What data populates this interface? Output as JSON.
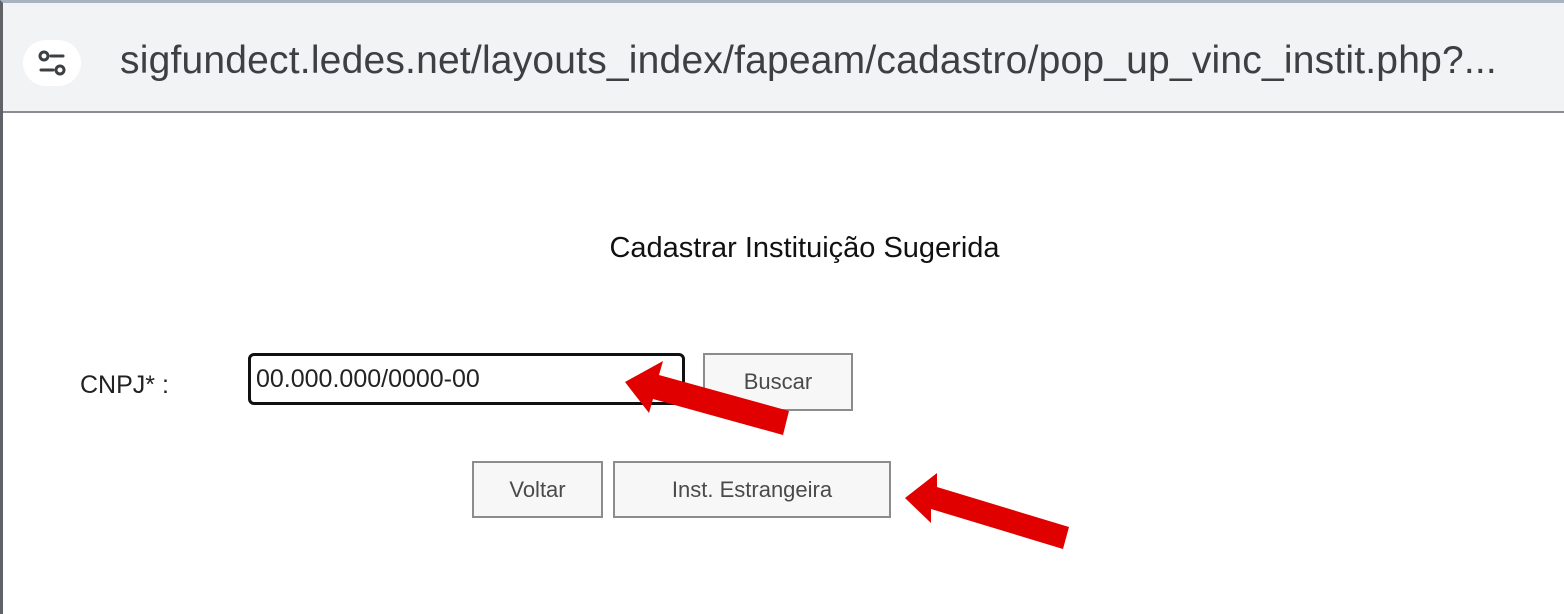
{
  "browser": {
    "url": "sigfundect.ledes.net/layouts_index/fapeam/cadastro/pop_up_vinc_instit.php?...",
    "site_info_icon": "tune-icon"
  },
  "form": {
    "title": "Cadastrar Instituição Sugerida",
    "cnpj_label": "CNPJ* :",
    "cnpj_value": "00.000.000/0000-00",
    "buscar_label": "Buscar",
    "voltar_label": "Voltar",
    "estrangeira_label": "Inst. Estrangeira"
  },
  "annotations": {
    "arrow_color": "#e00000"
  }
}
